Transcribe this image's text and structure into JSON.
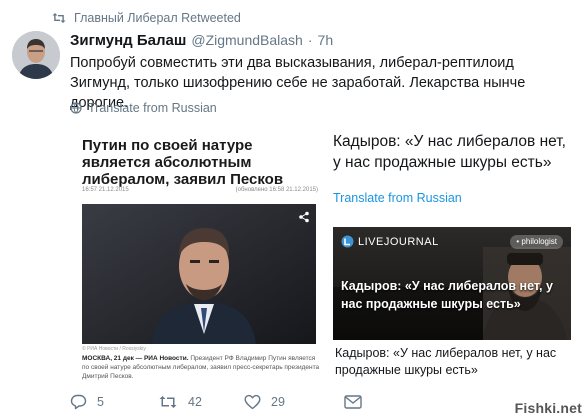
{
  "retweet": {
    "text": "Главный Либерал Retweeted",
    "icon": "retweet-icon"
  },
  "tweet": {
    "author_name": "Зигмунд Балаш",
    "handle": "@ZigmundBalash",
    "separator": "·",
    "time": "7h",
    "text": "Попробуй совместить эти два высказывания, либерал-рептилоид Зигмунд, только шизофрению себе не заработай. Лекарства нынче дорогие.",
    "translate_label": "Translate from Russian"
  },
  "news_card": {
    "title": "Путин по своей натуре является абсолютным либералом, заявил Песков",
    "meta_left": "16:57 21.12.2015",
    "meta_right": "(обновлено 16:58 21.12.2015)",
    "photo_credit": "© РИА Новости / Rossiyskiy",
    "lead_dateline": "МОСКВА, 21 дек — РИА Новости.",
    "lead_text": "Президент РФ Владимир Путин является по своей натуре абсолютным либералом, заявил пресс-секретарь президента Дмитрий Песков."
  },
  "quote_card": {
    "text": "Кадыров: «У нас либералов нет, у нас продажные шкуры есть»",
    "translate_label": "Translate from Russian"
  },
  "lj_card": {
    "logo": "LIVEJOURNAL",
    "badge": "• philologist",
    "headline": "Кадыров: «У нас либералов нет, у нас продажные шкуры есть»",
    "caption": "Кадыров: «У нас либералов нет, у нас продажные шкуры есть»"
  },
  "actions": {
    "reply_count": "5",
    "retweet_count": "42",
    "like_count": "29"
  },
  "watermark": "Fishki.net",
  "colors": {
    "text": "#14171a",
    "secondary": "#657786",
    "link": "#1b95e0",
    "lj_blue": "#3d93d4"
  }
}
